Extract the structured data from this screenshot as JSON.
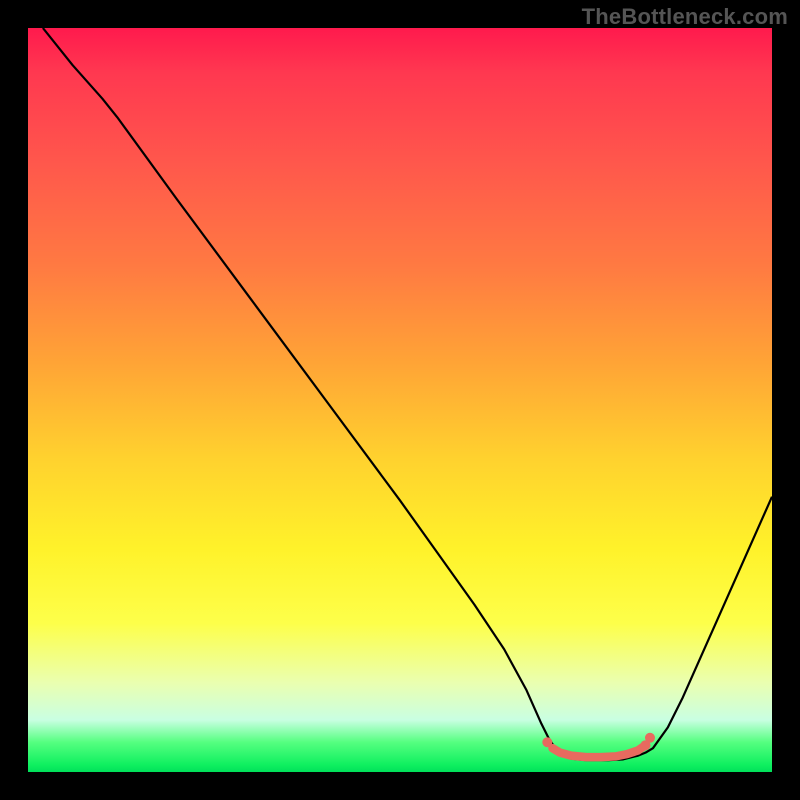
{
  "domain": "Chart",
  "watermark_text": "TheBottleneck.com",
  "chart_data": {
    "type": "line",
    "title": "",
    "xlabel": "",
    "ylabel": "",
    "xlim": [
      0,
      100
    ],
    "ylim": [
      0,
      100
    ],
    "series": [
      {
        "name": "curve",
        "color": "#000000",
        "stroke_width": 2.2,
        "points": [
          {
            "x": 2.0,
            "y": 100.0
          },
          {
            "x": 6.0,
            "y": 95.0
          },
          {
            "x": 10.0,
            "y": 90.5
          },
          {
            "x": 12.0,
            "y": 88.0
          },
          {
            "x": 20.0,
            "y": 77.0
          },
          {
            "x": 30.0,
            "y": 63.5
          },
          {
            "x": 40.0,
            "y": 50.0
          },
          {
            "x": 50.0,
            "y": 36.5
          },
          {
            "x": 55.0,
            "y": 29.5
          },
          {
            "x": 60.0,
            "y": 22.5
          },
          {
            "x": 64.0,
            "y": 16.5
          },
          {
            "x": 67.0,
            "y": 11.0
          },
          {
            "x": 69.0,
            "y": 6.5
          },
          {
            "x": 70.0,
            "y": 4.5
          },
          {
            "x": 71.0,
            "y": 3.0
          },
          {
            "x": 72.0,
            "y": 2.2
          },
          {
            "x": 73.0,
            "y": 1.8
          },
          {
            "x": 75.0,
            "y": 1.6
          },
          {
            "x": 78.0,
            "y": 1.6
          },
          {
            "x": 80.0,
            "y": 1.7
          },
          {
            "x": 82.0,
            "y": 2.2
          },
          {
            "x": 83.0,
            "y": 2.6
          },
          {
            "x": 84.0,
            "y": 3.2
          },
          {
            "x": 86.0,
            "y": 6.0
          },
          {
            "x": 88.0,
            "y": 10.0
          },
          {
            "x": 92.0,
            "y": 19.0
          },
          {
            "x": 96.0,
            "y": 28.0
          },
          {
            "x": 100.0,
            "y": 37.0
          }
        ]
      },
      {
        "name": "flat-bottom-highlight",
        "color": "#e86a5f",
        "stroke_width": 8.5,
        "stroke_linecap": "round",
        "points": [
          {
            "x": 70.5,
            "y": 3.2
          },
          {
            "x": 71.5,
            "y": 2.6
          },
          {
            "x": 73.0,
            "y": 2.2
          },
          {
            "x": 75.0,
            "y": 2.0
          },
          {
            "x": 77.0,
            "y": 2.0
          },
          {
            "x": 79.0,
            "y": 2.1
          },
          {
            "x": 80.5,
            "y": 2.4
          },
          {
            "x": 82.0,
            "y": 2.9
          },
          {
            "x": 83.0,
            "y": 3.6
          }
        ]
      }
    ],
    "scatter": [
      {
        "name": "marker-left",
        "x": 69.8,
        "y": 4.0,
        "r": 5,
        "color": "#e86a5f"
      },
      {
        "name": "marker-right-a",
        "x": 83.0,
        "y": 3.6,
        "r": 5,
        "color": "#e86a5f"
      },
      {
        "name": "marker-right-b",
        "x": 83.6,
        "y": 4.6,
        "r": 5,
        "color": "#e86a5f"
      }
    ]
  }
}
